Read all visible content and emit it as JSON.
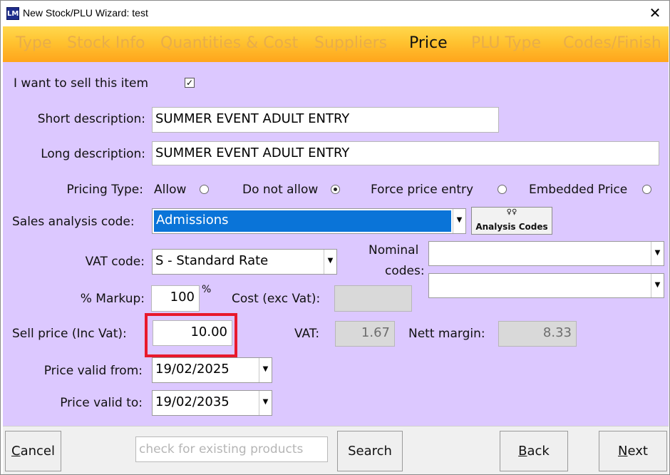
{
  "window": {
    "app_icon_text": "LM",
    "title": "New Stock/PLU Wizard: test",
    "close_glyph": "✕"
  },
  "tabs": [
    {
      "label": "Type",
      "active": false
    },
    {
      "label": "Stock Info",
      "active": false
    },
    {
      "label": "Quantities & Cost",
      "active": false
    },
    {
      "label": "Suppliers",
      "active": false
    },
    {
      "label": "Price",
      "active": true
    },
    {
      "label": "PLU Type",
      "active": false
    },
    {
      "label": "Codes/Finish",
      "active": false
    }
  ],
  "form": {
    "sell_item_label": "I want to sell this item",
    "sell_item_checked": true,
    "check_glyph": "✓",
    "short_desc_label": "Short description:",
    "short_desc_value": "SUMMER EVENT ADULT ENTRY",
    "long_desc_label": "Long description:",
    "long_desc_value": "SUMMER EVENT ADULT ENTRY",
    "pricing_type_label": "Pricing Type:",
    "pricing_options": [
      {
        "label": "Allow",
        "selected": false
      },
      {
        "label": "Do not allow",
        "selected": true
      },
      {
        "label": "Force price entry",
        "selected": false
      },
      {
        "label": "Embedded Price",
        "selected": false
      }
    ],
    "sales_analysis_label": "Sales analysis code:",
    "sales_analysis_value": "Admissions",
    "analysis_codes_button": "Analysis Codes",
    "analysis_codes_icon_glyph": "♀♀",
    "vat_code_label": "VAT code:",
    "vat_code_value": "S - Standard Rate",
    "nominal_codes_label_line1": "Nominal",
    "nominal_codes_label_line2": "codes:",
    "nominal_code_1": "",
    "nominal_code_2": "",
    "markup_label": "% Markup:",
    "markup_value": "100",
    "markup_unit": "%",
    "cost_label": "Cost (exc Vat):",
    "cost_value": "",
    "sell_price_label": "Sell price (Inc Vat):",
    "sell_price_value": "10.00",
    "vat_label": "VAT:",
    "vat_value": "1.67",
    "nett_margin_label": "Nett margin:",
    "nett_margin_value": "8.33",
    "price_valid_from_label": "Price valid from:",
    "price_valid_from_value": "19/02/2025",
    "price_valid_to_label": "Price valid to:",
    "price_valid_to_value": "19/02/2035",
    "dropdown_arrow_glyph": "▼"
  },
  "footer": {
    "cancel_label": "Cancel",
    "search_placeholder": "check for existing products",
    "search_button": "Search",
    "back_label": "Back",
    "next_label": "Next"
  },
  "colors": {
    "panel_bg": "#dcc8ff",
    "tab_gradient_top": "#ffd84e",
    "tab_gradient_bottom": "#ffa51c",
    "tab_inactive_text": "#e8ad4a",
    "highlight_border": "#e8192c",
    "selection_blue": "#0a74d8"
  }
}
